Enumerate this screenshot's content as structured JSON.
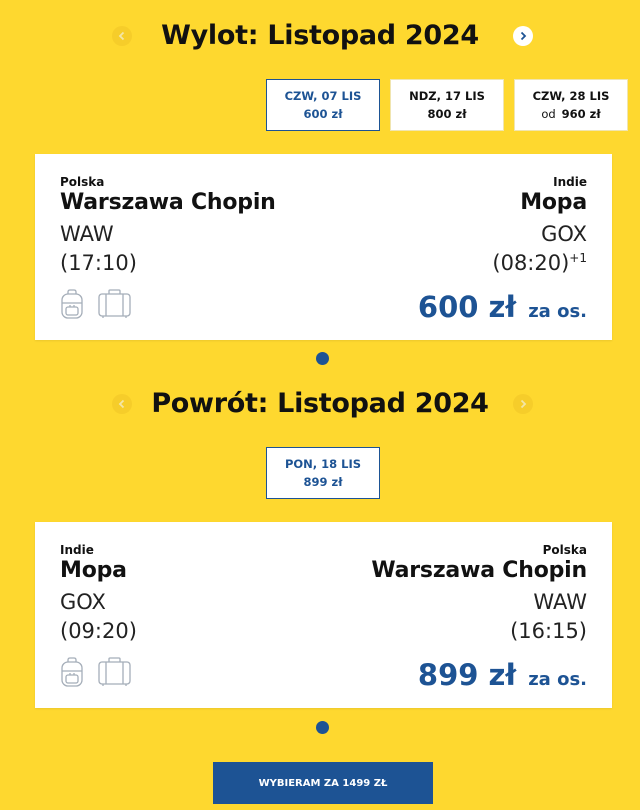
{
  "outbound": {
    "title": "Wylot: Listopad 2024",
    "date_tabs": [
      {
        "date": "CZW, 07 LIS",
        "price": "600 zł",
        "selected": true
      },
      {
        "date": "NDZ, 17 LIS",
        "price": "800 zł",
        "selected": false
      },
      {
        "date": "CZW, 28 LIS",
        "price_prefix": "od",
        "price": "960 zł",
        "selected": false
      }
    ],
    "card": {
      "origin_country": "Polska",
      "origin_airport": "Warszawa Chopin",
      "origin_code": "WAW",
      "departure_time": "(17:10)",
      "dest_country": "Indie",
      "dest_airport": "Mopa",
      "dest_code": "GOX",
      "arrival_time": "(08:20)",
      "day_offset": "+1",
      "price": "600 zł",
      "price_suffix": "za os."
    }
  },
  "return": {
    "title": "Powrót: Listopad 2024",
    "date_tabs": [
      {
        "date": "PON, 18 LIS",
        "price": "899 zł",
        "selected": true
      }
    ],
    "card": {
      "origin_country": "Indie",
      "origin_airport": "Mopa",
      "origin_code": "GOX",
      "departure_time": "(09:20)",
      "dest_country": "Polska",
      "dest_airport": "Warszawa Chopin",
      "dest_code": "WAW",
      "arrival_time": "(16:15)",
      "price": "899 zł",
      "price_suffix": "za os."
    }
  },
  "footer": {
    "select_button": "WYBIERAM ZA 1499 ZŁ"
  },
  "colors": {
    "background": "#fed82f",
    "accent": "#1d5394",
    "card": "#ffffff"
  },
  "icons": [
    "chevron-left-icon",
    "chevron-right-icon",
    "backpack-icon",
    "suitcase-icon"
  ]
}
